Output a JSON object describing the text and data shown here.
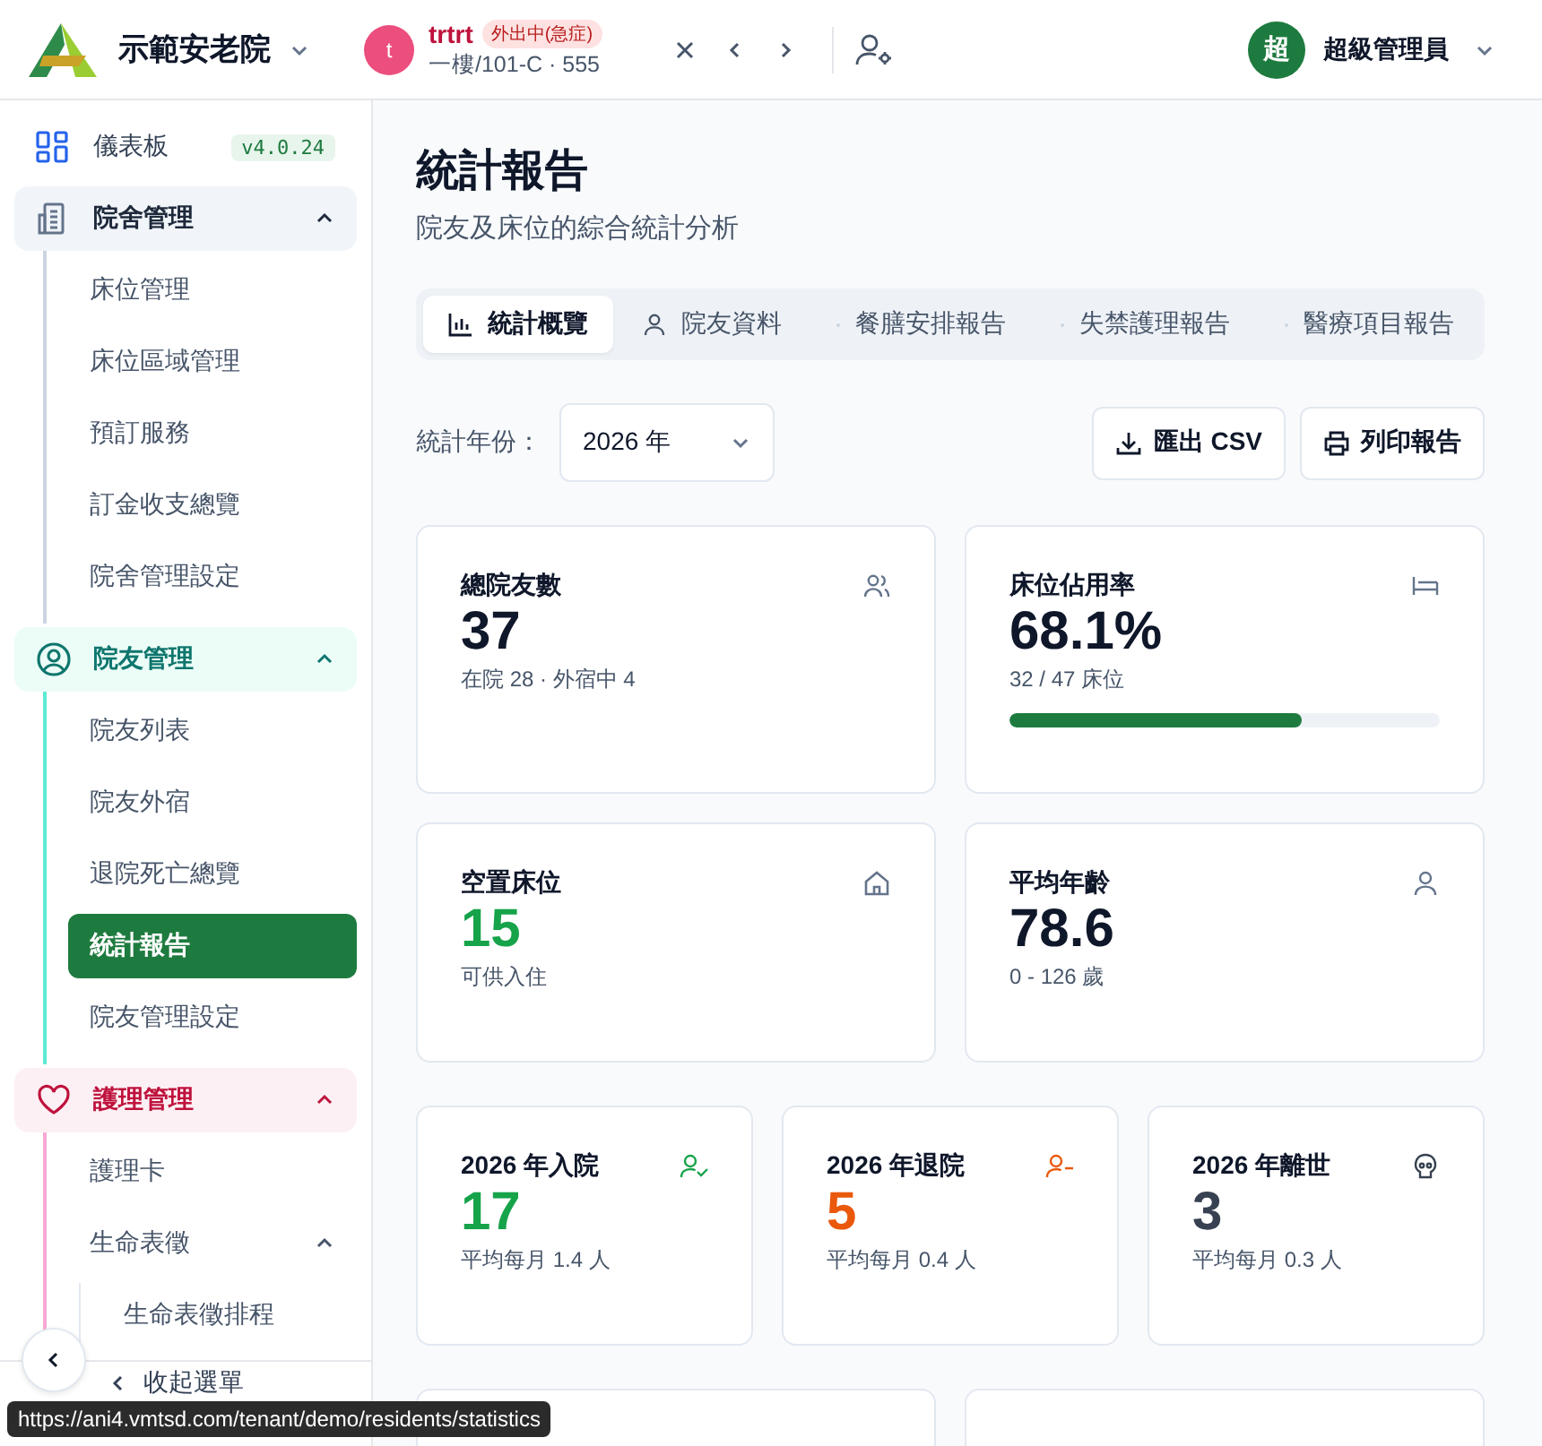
{
  "header": {
    "org_name": "示範安老院",
    "resident": {
      "avatar": "t",
      "name": "trtrt",
      "status": "外出中(急症)",
      "location": "一樓/101-C · 555"
    },
    "user": {
      "avatar": "超",
      "name": "超級管理員"
    }
  },
  "sidebar": {
    "dashboard": {
      "label": "儀表板",
      "version": "v4.0.24"
    },
    "groups": [
      {
        "label": "院舍管理",
        "color": "#64748b",
        "expanded": true,
        "children": [
          {
            "label": "床位管理",
            "selected": false
          },
          {
            "label": "床位區域管理",
            "selected": false
          },
          {
            "label": "預訂服務",
            "selected": false
          },
          {
            "label": "訂金收支總覽",
            "selected": false
          },
          {
            "label": "院舍管理設定",
            "selected": false
          }
        ]
      },
      {
        "label": "院友管理",
        "color": "#0f766e",
        "expanded": true,
        "children": [
          {
            "label": "院友列表",
            "selected": false
          },
          {
            "label": "院友外宿",
            "selected": false
          },
          {
            "label": "退院死亡總覽",
            "selected": false
          },
          {
            "label": "統計報告",
            "selected": true
          },
          {
            "label": "院友管理設定",
            "selected": false
          }
        ]
      },
      {
        "label": "護理管理",
        "color": "#be123c",
        "expanded": true,
        "children": [
          {
            "label": "護理卡",
            "selected": false
          },
          {
            "label": "生命表徵",
            "selected": false,
            "expanded": true,
            "children": [
              {
                "label": "生命表徵排程",
                "selected": false
              }
            ]
          }
        ]
      }
    ],
    "collapse_label": "收起選單"
  },
  "main": {
    "title": "統計報告",
    "subtitle": "院友及床位的綜合統計分析",
    "tabs": [
      {
        "label": "統計概覽",
        "selected": true
      },
      {
        "label": "院友資料",
        "selected": false
      },
      {
        "label": "餐膳安排報告",
        "selected": false
      },
      {
        "label": "失禁護理報告",
        "selected": false
      },
      {
        "label": "醫療項目報告",
        "selected": false
      }
    ],
    "year_label": "統計年份：",
    "year_value": "2026 年",
    "buttons": [
      "匯出 CSV",
      "列印報告"
    ],
    "stats": [
      {
        "label": "總院友數",
        "value": "37",
        "note": "在院 28 · 外宿中 4",
        "color": "#0f172a"
      },
      {
        "label": "床位佔用率",
        "value": "68.1%",
        "note": "32 / 47 床位",
        "color": "#0f172a",
        "level": 0.681
      },
      {
        "label": "空置床位",
        "value": "15",
        "note": "可供入住",
        "color": "#16a34a"
      },
      {
        "label": "平均年齡",
        "value": "78.6",
        "note": "0 - 126 歲",
        "color": "#0f172a"
      }
    ],
    "yearly": [
      {
        "label": "2026 年入院",
        "value": "17",
        "note": "平均每月 1.4 人",
        "color": "#16a34a"
      },
      {
        "label": "2026 年退院",
        "value": "5",
        "note": "平均每月 0.4 人",
        "color": "#ea580c"
      },
      {
        "label": "2026 年離世",
        "value": "3",
        "note": "平均每月 0.3 人",
        "color": "#374151"
      }
    ]
  },
  "status_url": "https://ani4.vmtsd.com/tenant/demo/residents/statistics"
}
